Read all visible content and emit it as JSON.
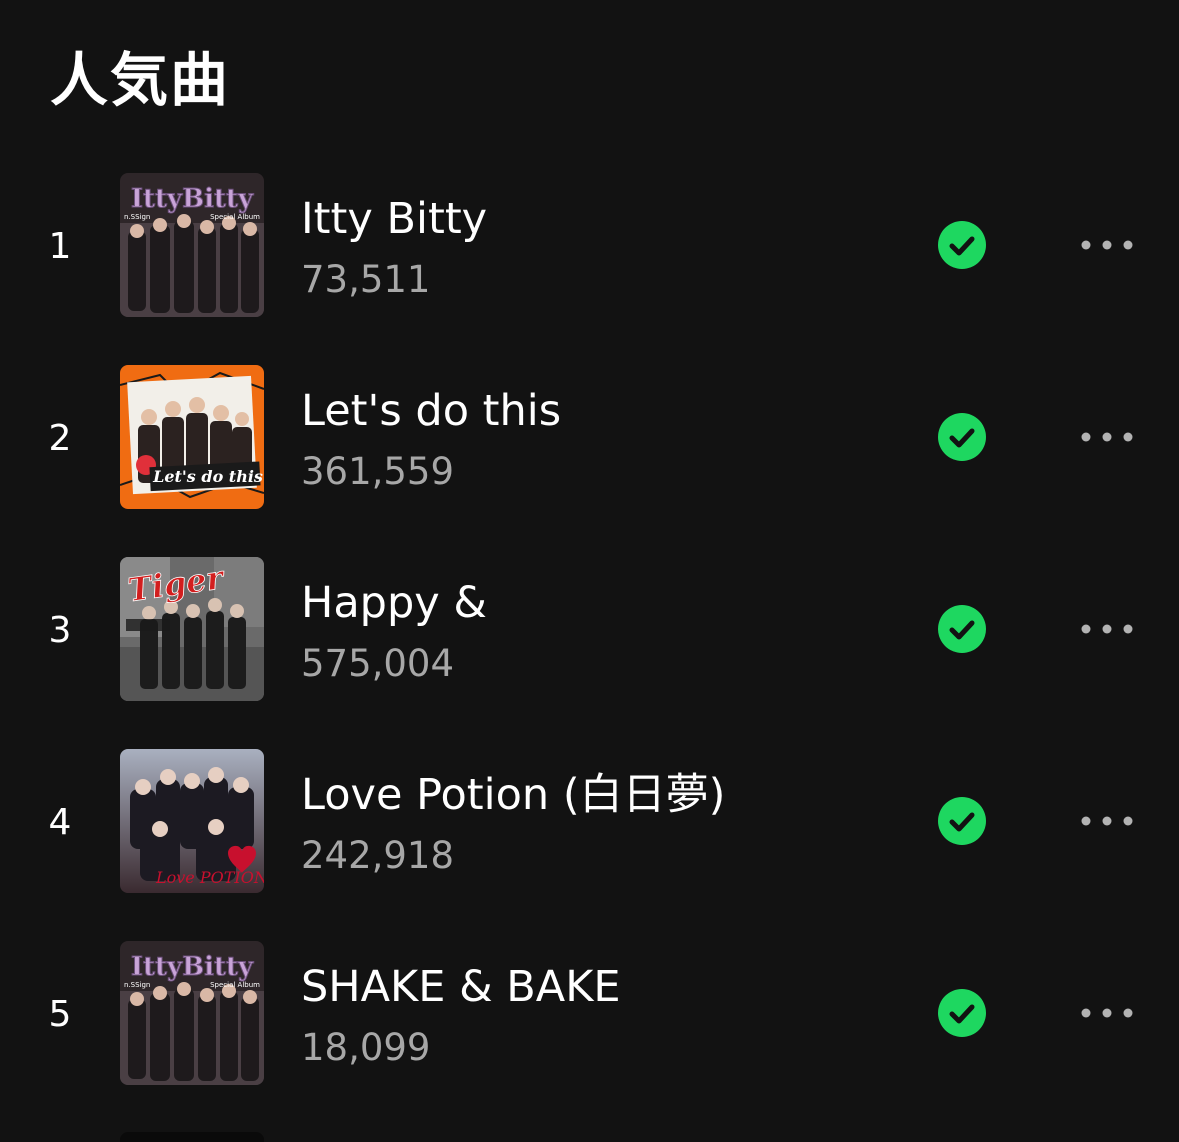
{
  "section": {
    "title": "人気曲"
  },
  "tracks": [
    {
      "rank": "1",
      "title": "Itty Bitty",
      "plays": "73,511",
      "cover": {
        "icon": "itty-bitty-album-cover",
        "text": "IttyBitty",
        "sub_left": "n.SSign",
        "sub_right": "Special Album",
        "bg": "#3a3034",
        "accent": "#c9a4d8"
      }
    },
    {
      "rank": "2",
      "title": "Let's do this",
      "plays": "361,559",
      "cover": {
        "icon": "lets-do-this-album-cover",
        "text": "Let's do this",
        "bg": "#f06c12",
        "accent": "#ffffff"
      }
    },
    {
      "rank": "3",
      "title": "Happy &",
      "plays": "575,004",
      "cover": {
        "icon": "tiger-album-cover",
        "text": "Tiger",
        "bg": "#5a5a5a",
        "accent": "#d21e1e"
      }
    },
    {
      "rank": "4",
      "title": "Love Potion (白日夢)",
      "plays": "242,918",
      "cover": {
        "icon": "love-potion-album-cover",
        "text": "Love POTION",
        "bg": "#8a8fa0",
        "accent": "#c8102e"
      }
    },
    {
      "rank": "5",
      "title": "SHAKE & BAKE",
      "plays": "18,099",
      "cover": {
        "icon": "itty-bitty-album-cover",
        "text": "IttyBitty",
        "sub_left": "n.SSign",
        "sub_right": "Special Album",
        "bg": "#3a3034",
        "accent": "#c9a4d8"
      }
    }
  ],
  "colors": {
    "background": "#121212",
    "saved_green": "#1ed760",
    "secondary_text": "#a7a7a7"
  }
}
